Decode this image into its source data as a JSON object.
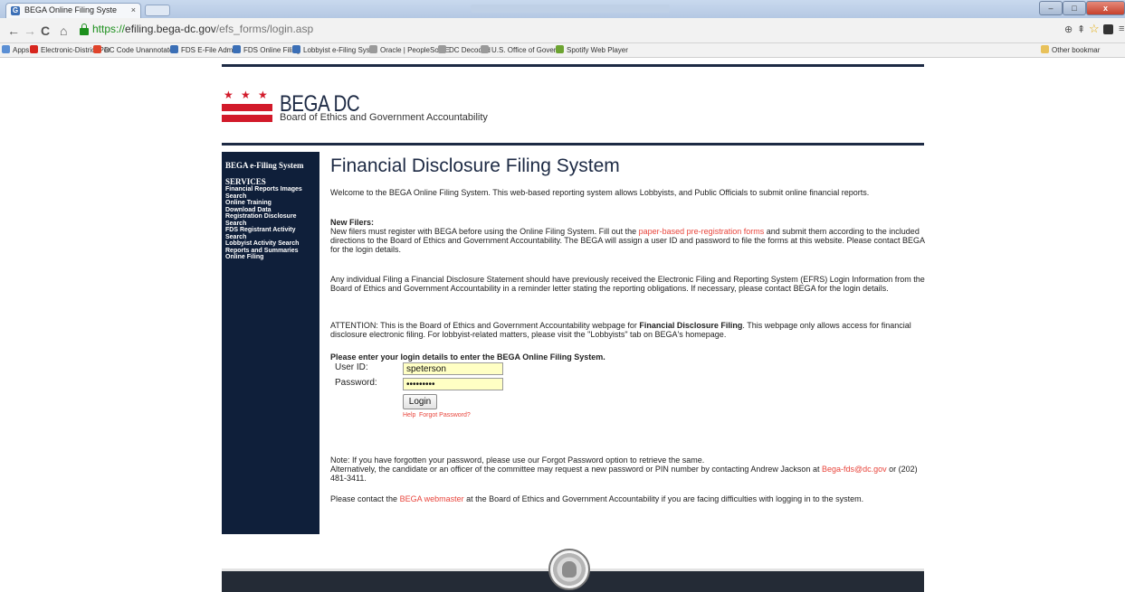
{
  "browser": {
    "tab_title": "BEGA Online Filing Syste",
    "tab_close": "×",
    "url_scheme": "https://",
    "url_host": "efiling.bega-dc.gov",
    "url_path": "/efs_forms/login.asp",
    "controls": {
      "back": "←",
      "forward": "→",
      "reload": "C",
      "home": "⌂",
      "minimize": "–",
      "maximize": "□",
      "close": "x"
    },
    "toolbar_icons": {
      "zoom": "⊕",
      "extension": "⇞",
      "star": "☆",
      "menu": "≡"
    },
    "bookmarks": [
      {
        "label": "Apps",
        "color": "#5b8fd4"
      },
      {
        "label": "Electronic-District Per",
        "color": "#d7261e"
      },
      {
        "label": "DC Code Unannotate",
        "color": "#e0442b"
      },
      {
        "label": "FDS E-File Admin",
        "color": "#3b6fb6"
      },
      {
        "label": "FDS Online Filing",
        "color": "#3b6fb6"
      },
      {
        "label": "Lobbyist e-Filing Syste",
        "color": "#3b6fb6"
      },
      {
        "label": "Oracle | PeopleSoft E",
        "color": "#9a9a9a"
      },
      {
        "label": "DC Decoded",
        "color": "#9a9a9a"
      },
      {
        "label": "U.S. Office of Governr",
        "color": "#9a9a9a"
      },
      {
        "label": "Spotify Web Player",
        "color": "#6da431"
      }
    ],
    "other_bookmarks": "Other bookmar"
  },
  "logo": {
    "title": "BEGA DC",
    "subtitle": "Board of Ethics and Government Accountability"
  },
  "sidebar": {
    "title": "BEGA e-Filing System",
    "services_heading": "SERVICES",
    "links": [
      "Financial Reports Images Search",
      "Online Training",
      "Download Data",
      "Registration Disclosure Search",
      "FDS Registrant Activity Search",
      "Lobbyist Activity Search",
      "Reports and Summaries",
      "Online Filing"
    ]
  },
  "main": {
    "title": "Financial Disclosure Filing System",
    "welcome": "Welcome to the BEGA Online Filing System. This web-based reporting system allows Lobbyists, and Public Officials to submit online financial reports.",
    "new_filers_heading": "New Filers:",
    "new_filers_text_1": "New filers must register with BEGA before using the Online Filing System. Fill out the ",
    "new_filers_link": "paper-based pre-registration forms",
    "new_filers_text_2": " and submit them according to the included directions to the Board of Ethics and Government Accountability. The BEGA will assign a user ID and password to file the forms at this website. Please contact BEGA for the login details.",
    "individual_text": "Any individual Filing a Financial Disclosure Statement should have previously received the Electronic Filing and Reporting System (EFRS) Login Information from the Board of Ethics and Government Accountability in a reminder letter stating the reporting obligations. If necessary, please contact BEGA for the login details.",
    "attention_1": "ATTENTION: This is the Board of Ethics and Government Accountability webpage for ",
    "attention_bold": "Financial Disclosure Filing",
    "attention_2": ". This webpage only allows access for financial disclosure electronic filing. For lobbyist-related matters, please visit the \"Lobbyists\" tab on BEGA's homepage.",
    "login_heading": "Please enter your login details to enter the BEGA Online Filing System.",
    "user_id_label": "User ID:",
    "user_id_value": "speterson",
    "password_label": "Password:",
    "password_value": "•••••••••",
    "login_button": "Login",
    "help_link": "Help",
    "forgot_link": "Forgot Password?",
    "note_1": "Note: If you have forgotten your password, please use our Forgot Password option to retrieve the same.",
    "note_2": "Alternatively, the candidate or an officer of the committee may request a new password or PIN number by contacting Andrew Jackson at ",
    "note_email": "Bega-fds@dc.gov",
    "note_3": " or (202) 481-3411.",
    "contact_1": "Please contact the ",
    "contact_link": "BEGA webmaster",
    "contact_2": " at the Board of Ethics and Government Accountability if you are facing difficulties with logging in to the system."
  },
  "colors": {
    "navy": "#1d2a44",
    "sidebar": "#0f1f3a",
    "dc_red": "#d21a2a",
    "link_red": "#e8453c",
    "input_bg": "#ffffc4"
  }
}
